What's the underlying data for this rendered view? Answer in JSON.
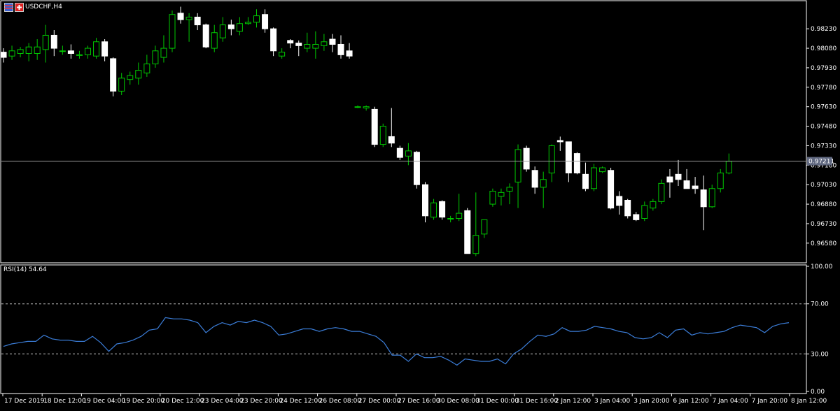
{
  "colors": {
    "background": "#000000",
    "frame": "#ffffff",
    "candle_up_fill": "#000000",
    "candle_up_wick": "#00c800",
    "candle_down_fill": "#ffffff",
    "candle_down_wick": "#ffffff",
    "rsi_line": "#3b7dd8",
    "level_line": "#c0c0c0",
    "axis_text": "#ffffff",
    "price_tag_bg": "#606880"
  },
  "header": {
    "symbol": "USDCHF,H4",
    "icon": "flag-icon"
  },
  "chart_data": [
    {
      "type": "candlestick",
      "title": "USDCHF,H4",
      "ylim": [
        0.9645,
        0.9843
      ],
      "yticks": [
        "0.98230",
        "0.98080",
        "0.97930",
        "0.97780",
        "0.97630",
        "0.97480",
        "0.97330",
        "0.97180",
        "0.97030",
        "0.96880",
        "0.96730",
        "0.96580"
      ],
      "ytick_values": [
        0.9823,
        0.9808,
        0.9793,
        0.9778,
        0.9763,
        0.9748,
        0.9733,
        0.9718,
        0.9703,
        0.9688,
        0.9673,
        0.9658
      ],
      "current_price": 0.97211,
      "current_price_label": "0.97211",
      "xticks": [
        "17 Dec 2019",
        "18 Dec 12:00",
        "19 Dec 04:00",
        "19 Dec 20:00",
        "20 Dec 12:00",
        "23 Dec 04:00",
        "23 Dec 20:00",
        "24 Dec 12:00",
        "26 Dec 08:00",
        "27 Dec 00:00",
        "27 Dec 16:00",
        "30 Dec 08:00",
        "31 Dec 00:00",
        "31 Dec 16:00",
        "2 Jan 12:00",
        "3 Jan 04:00",
        "3 Jan 20:00",
        "6 Jan 12:00",
        "7 Jan 04:00",
        "7 Jan 20:00",
        "8 Jan 12:00"
      ],
      "candles": [
        [
          0.9805,
          0.9808,
          0.9797,
          0.9801
        ],
        [
          0.9802,
          0.981,
          0.9799,
          0.9806
        ],
        [
          0.9804,
          0.9809,
          0.9801,
          0.9807
        ],
        [
          0.9804,
          0.9812,
          0.9798,
          0.9809
        ],
        [
          0.9804,
          0.9815,
          0.9799,
          0.9809
        ],
        [
          0.9807,
          0.9826,
          0.9797,
          0.9818
        ],
        [
          0.9818,
          0.9822,
          0.9802,
          0.9808
        ],
        [
          0.9806,
          0.981,
          0.9803,
          0.9806
        ],
        [
          0.9806,
          0.9811,
          0.98,
          0.9804
        ],
        [
          0.9803,
          0.9806,
          0.98,
          0.9803
        ],
        [
          0.9803,
          0.981,
          0.98,
          0.9808
        ],
        [
          0.9802,
          0.9816,
          0.98,
          0.9813
        ],
        [
          0.9813,
          0.9815,
          0.9798,
          0.9802
        ],
        [
          0.98,
          0.9801,
          0.9771,
          0.9775
        ],
        [
          0.9775,
          0.9789,
          0.9772,
          0.9785
        ],
        [
          0.9784,
          0.979,
          0.978,
          0.9787
        ],
        [
          0.9785,
          0.9797,
          0.978,
          0.9791
        ],
        [
          0.9789,
          0.9803,
          0.9786,
          0.9796
        ],
        [
          0.9796,
          0.981,
          0.9793,
          0.9806
        ],
        [
          0.9801,
          0.9818,
          0.9797,
          0.9808
        ],
        [
          0.9808,
          0.9837,
          0.9805,
          0.9834
        ],
        [
          0.9835,
          0.984,
          0.9827,
          0.983
        ],
        [
          0.983,
          0.9835,
          0.9813,
          0.9832
        ],
        [
          0.9832,
          0.9835,
          0.9822,
          0.9826
        ],
        [
          0.9826,
          0.9827,
          0.9808,
          0.9809
        ],
        [
          0.9808,
          0.9826,
          0.9805,
          0.982
        ],
        [
          0.9816,
          0.9832,
          0.9813,
          0.9826
        ],
        [
          0.9826,
          0.983,
          0.9818,
          0.9823
        ],
        [
          0.9821,
          0.9832,
          0.9818,
          0.9827
        ],
        [
          0.9827,
          0.9832,
          0.9826,
          0.9828
        ],
        [
          0.9828,
          0.9838,
          0.9824,
          0.9833
        ],
        [
          0.9834,
          0.9838,
          0.982,
          0.9823
        ],
        [
          0.9823,
          0.9824,
          0.9802,
          0.9806
        ],
        [
          0.9802,
          0.9808,
          0.98,
          0.9805
        ],
        [
          0.9814,
          0.9815,
          0.9808,
          0.9812
        ],
        [
          0.9812,
          0.9814,
          0.9802,
          0.981
        ],
        [
          0.9808,
          0.982,
          0.9805,
          0.9811
        ],
        [
          0.9808,
          0.9821,
          0.98,
          0.9811
        ],
        [
          0.981,
          0.9819,
          0.9806,
          0.9813
        ],
        [
          0.9815,
          0.9819,
          0.9805,
          0.9811
        ],
        [
          0.9811,
          0.9818,
          0.98,
          0.9803
        ],
        [
          0.9806,
          0.9812,
          0.98,
          0.9802
        ],
        [
          0.9763,
          0.9764,
          0.9762,
          0.9763
        ],
        [
          0.9762,
          0.9764,
          0.976,
          0.9763
        ],
        [
          0.9761,
          0.9763,
          0.9732,
          0.9734
        ],
        [
          0.9734,
          0.975,
          0.9732,
          0.9748
        ],
        [
          0.974,
          0.9762,
          0.9732,
          0.9735
        ],
        [
          0.9731,
          0.9733,
          0.9722,
          0.9724
        ],
        [
          0.9725,
          0.9735,
          0.9718,
          0.9729
        ],
        [
          0.9728,
          0.9729,
          0.97,
          0.9703
        ],
        [
          0.9703,
          0.9705,
          0.9674,
          0.9679
        ],
        [
          0.9678,
          0.9692,
          0.9676,
          0.9689
        ],
        [
          0.969,
          0.9691,
          0.9676,
          0.9678
        ],
        [
          0.9677,
          0.9679,
          0.9674,
          0.9677
        ],
        [
          0.9677,
          0.9696,
          0.9675,
          0.9681
        ],
        [
          0.9683,
          0.9685,
          0.965,
          0.965
        ],
        [
          0.965,
          0.9697,
          0.9648,
          0.9664
        ],
        [
          0.9665,
          0.9676,
          0.9662,
          0.9676
        ],
        [
          0.9688,
          0.97,
          0.9686,
          0.9698
        ],
        [
          0.9694,
          0.97,
          0.9687,
          0.9697
        ],
        [
          0.9698,
          0.9704,
          0.9688,
          0.9701
        ],
        [
          0.9705,
          0.9734,
          0.9685,
          0.973
        ],
        [
          0.9731,
          0.9733,
          0.9713,
          0.9715
        ],
        [
          0.9714,
          0.9717,
          0.9696,
          0.9701
        ],
        [
          0.9701,
          0.9713,
          0.9685,
          0.9707
        ],
        [
          0.9712,
          0.9734,
          0.9705,
          0.9733
        ],
        [
          0.9737,
          0.974,
          0.9729,
          0.9736
        ],
        [
          0.9736,
          0.9735,
          0.9705,
          0.9712
        ],
        [
          0.9727,
          0.9728,
          0.9711,
          0.9712
        ],
        [
          0.9711,
          0.972,
          0.9698,
          0.97
        ],
        [
          0.97,
          0.9719,
          0.9698,
          0.9716
        ],
        [
          0.9713,
          0.9717,
          0.9712,
          0.9716
        ],
        [
          0.9714,
          0.9716,
          0.9684,
          0.9685
        ],
        [
          0.9694,
          0.9698,
          0.968,
          0.9687
        ],
        [
          0.9691,
          0.9692,
          0.9677,
          0.9679
        ],
        [
          0.968,
          0.9682,
          0.9675,
          0.9676
        ],
        [
          0.9677,
          0.969,
          0.9675,
          0.9687
        ],
        [
          0.9685,
          0.9692,
          0.9683,
          0.969
        ],
        [
          0.969,
          0.9707,
          0.9688,
          0.9704
        ],
        [
          0.9709,
          0.9715,
          0.9693,
          0.9705
        ],
        [
          0.9711,
          0.9722,
          0.9702,
          0.9707
        ],
        [
          0.9706,
          0.9715,
          0.97,
          0.97
        ],
        [
          0.9702,
          0.9709,
          0.9696,
          0.97
        ],
        [
          0.9699,
          0.971,
          0.9668,
          0.9686
        ],
        [
          0.9686,
          0.9703,
          0.9685,
          0.97
        ],
        [
          0.97,
          0.9715,
          0.9697,
          0.9712
        ],
        [
          0.9712,
          0.9727,
          0.9711,
          0.9721
        ]
      ]
    },
    {
      "type": "line",
      "title": "RSI(14) 54.64",
      "ylim": [
        0,
        100
      ],
      "yticks": [
        "100.00",
        "70.00",
        "30.00",
        "0.00"
      ],
      "ytick_values": [
        100,
        70,
        30,
        0
      ],
      "levels": [
        70,
        30
      ],
      "series": [
        {
          "values": [
            36,
            38,
            39,
            40,
            40,
            45,
            42,
            41,
            41,
            40,
            40,
            44,
            39,
            32,
            38,
            39,
            41,
            44,
            49,
            50,
            59,
            58,
            58,
            57,
            55,
            47,
            52,
            55,
            53,
            56,
            55,
            57,
            55,
            52,
            45,
            46,
            48,
            50,
            50,
            48,
            50,
            51,
            50,
            48,
            48,
            46,
            44,
            39,
            29,
            29,
            24,
            30,
            27,
            27,
            28,
            25,
            21,
            26,
            25,
            24,
            24,
            26,
            22,
            30,
            34,
            40,
            45,
            44,
            46,
            51,
            48,
            48,
            49,
            52,
            51,
            50,
            48,
            47,
            43,
            42,
            43,
            47,
            43,
            49,
            50,
            45,
            47,
            46,
            47,
            48,
            51,
            53,
            52,
            51,
            47,
            52,
            54,
            55
          ]
        }
      ]
    }
  ]
}
